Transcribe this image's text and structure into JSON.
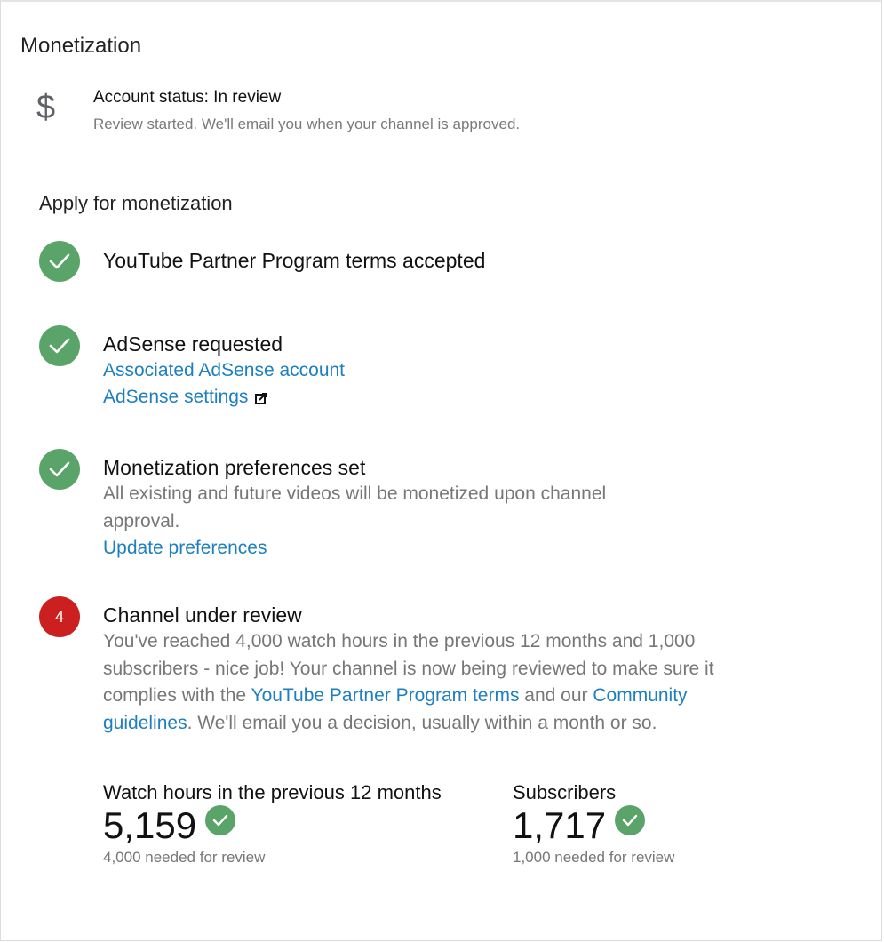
{
  "page": {
    "title": "Monetization"
  },
  "account_status": {
    "icon": "dollar-icon",
    "icon_glyph": "$",
    "title": "Account status: In review",
    "subtitle": "Review started. We'll email you when your channel is approved."
  },
  "apply": {
    "title": "Apply for monetization",
    "steps": [
      {
        "status": "done",
        "title": "YouTube Partner Program terms accepted"
      },
      {
        "status": "done",
        "title": "AdSense requested",
        "links": [
          "Associated AdSense account",
          "AdSense settings"
        ]
      },
      {
        "status": "done",
        "title": "Monetization preferences set",
        "description": "All existing and future videos will be monetized upon channel approval.",
        "link": "Update preferences"
      },
      {
        "status": "pending",
        "number": "4",
        "title": "Channel under review",
        "desc_part1": "You've reached 4,000 watch hours in the previous 12 months and 1,000 subscribers - nice job! Your channel is now being reviewed to make sure it complies with the ",
        "desc_link1": "YouTube Partner Program terms",
        "desc_part2": " and our ",
        "desc_link2": "Community guidelines",
        "desc_part3": ". We'll email you a decision, usually within a month or so."
      }
    ]
  },
  "metrics": {
    "watch_hours": {
      "label": "Watch hours in the previous 12 months",
      "value": "5,159",
      "note": "4,000 needed for review"
    },
    "subscribers": {
      "label": "Subscribers",
      "value": "1,717",
      "note": "1,000 needed for review"
    }
  },
  "colors": {
    "check_green": "#5ba469",
    "badge_red": "#cc1f1f",
    "link_blue": "#1d7fbf"
  }
}
